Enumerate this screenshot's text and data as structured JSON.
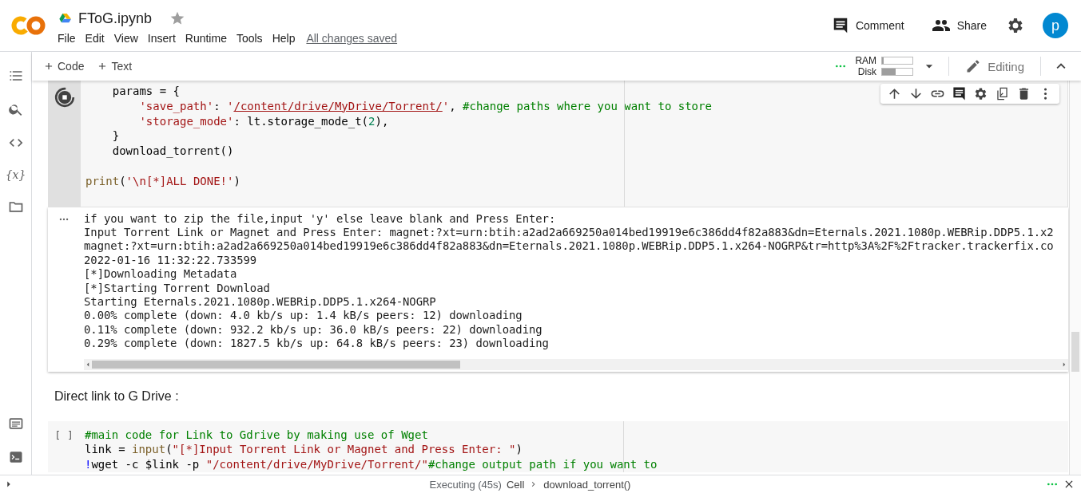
{
  "header": {
    "title": "FToG.ipynb",
    "starred": false,
    "menu": [
      "File",
      "Edit",
      "View",
      "Insert",
      "Runtime",
      "Tools",
      "Help"
    ],
    "save_status": "All changes saved",
    "comment_label": "Comment",
    "share_label": "Share",
    "avatar_letter": "p"
  },
  "toolbar": {
    "add_code_label": "Code",
    "add_text_label": "Text",
    "connected": true,
    "resources": [
      {
        "label": "RAM",
        "level": 0.05
      },
      {
        "label": "Disk",
        "level": 0.45
      }
    ],
    "mode_label": "Editing"
  },
  "cells": [
    {
      "kind": "code",
      "running": true,
      "lines": [
        {
          "kind": "code",
          "tokens": [
            {
              "kind": "plain",
              "text": "    params = {"
            }
          ]
        },
        {
          "kind": "code",
          "tokens": [
            {
              "kind": "string",
              "text": "        'save_path'"
            },
            {
              "kind": "plain",
              "text": ": "
            },
            {
              "kind": "string",
              "text": "'"
            },
            {
              "kind": "link",
              "text": "/content/drive/MyDrive/Torrent/"
            },
            {
              "kind": "string",
              "text": "'"
            },
            {
              "kind": "plain",
              "text": ", "
            },
            {
              "kind": "comment",
              "text": "#change paths where you want to store"
            }
          ]
        },
        {
          "kind": "code",
          "tokens": [
            {
              "kind": "string",
              "text": "        'storage_mode'"
            },
            {
              "kind": "plain",
              "text": ": lt.storage_mode_t("
            },
            {
              "kind": "number",
              "text": "2"
            },
            {
              "kind": "plain",
              "text": "),"
            }
          ]
        },
        {
          "kind": "code",
          "tokens": [
            {
              "kind": "plain",
              "text": "    }"
            }
          ]
        },
        {
          "kind": "code",
          "tokens": [
            {
              "kind": "plain",
              "text": "    download_torrent()"
            }
          ]
        },
        {
          "kind": "blank"
        },
        {
          "kind": "code",
          "tokens": [
            {
              "kind": "func",
              "text": "print"
            },
            {
              "kind": "plain",
              "text": "("
            },
            {
              "kind": "string",
              "text": "'\\n[*]ALL DONE!'"
            },
            {
              "kind": "plain",
              "text": ")"
            }
          ]
        }
      ],
      "output": [
        "if you want to zip the file,input 'y' else leave blank and Press Enter:",
        "Input Torrent Link or Magnet and Press Enter: magnet:?xt=urn:btih:a2ad2a669250a014bed19919e6c386dd4f82a883&dn=Eternals.2021.1080p.WEBRip.DDP5.1.x2",
        "magnet:?xt=urn:btih:a2ad2a669250a014bed19919e6c386dd4f82a883&dn=Eternals.2021.1080p.WEBRip.DDP5.1.x264-NOGRP&tr=http%3A%2F%2Ftracker.trackerfix.co",
        "2022-01-16 11:32:22.733599",
        "[*]Downloading Metadata",
        "[*]Starting Torrent Download",
        "Starting Eternals.2021.1080p.WEBRip.DDP5.1.x264-NOGRP",
        "0.00% complete (down: 4.0 kb/s up: 1.4 kB/s peers: 12) downloading",
        "0.11% complete (down: 932.2 kb/s up: 36.0 kB/s peers: 22) downloading",
        "0.29% complete (down: 1827.5 kb/s up: 64.8 kB/s peers: 23) downloading"
      ]
    },
    {
      "kind": "text",
      "text": "Direct link to G Drive :"
    },
    {
      "kind": "code",
      "running": false,
      "execution_count": "[ ]",
      "lines": [
        {
          "kind": "code",
          "tokens": [
            {
              "kind": "comment",
              "text": "#main code for Link to Gdrive by making use of Wget"
            }
          ]
        },
        {
          "kind": "code",
          "tokens": [
            {
              "kind": "plain",
              "text": "link = "
            },
            {
              "kind": "func",
              "text": "input"
            },
            {
              "kind": "plain",
              "text": "("
            },
            {
              "kind": "string",
              "text": "\"[*]Input Torrent Link or Magnet and Press Enter: \""
            },
            {
              "kind": "plain",
              "text": ")"
            }
          ]
        },
        {
          "kind": "code",
          "tokens": [
            {
              "kind": "keyword",
              "text": "!"
            },
            {
              "kind": "plain",
              "text": "wget -c $link -p "
            },
            {
              "kind": "string",
              "text": "\"/content/drive/MyDrive/Torrent/\""
            },
            {
              "kind": "comment",
              "text": "#change output path if you want to"
            }
          ]
        }
      ]
    }
  ],
  "sidebar": {
    "variables_label": "{x}"
  },
  "status_bar": {
    "state": "Executing (45s)",
    "cell_label": "Cell",
    "function": "download_torrent()"
  }
}
